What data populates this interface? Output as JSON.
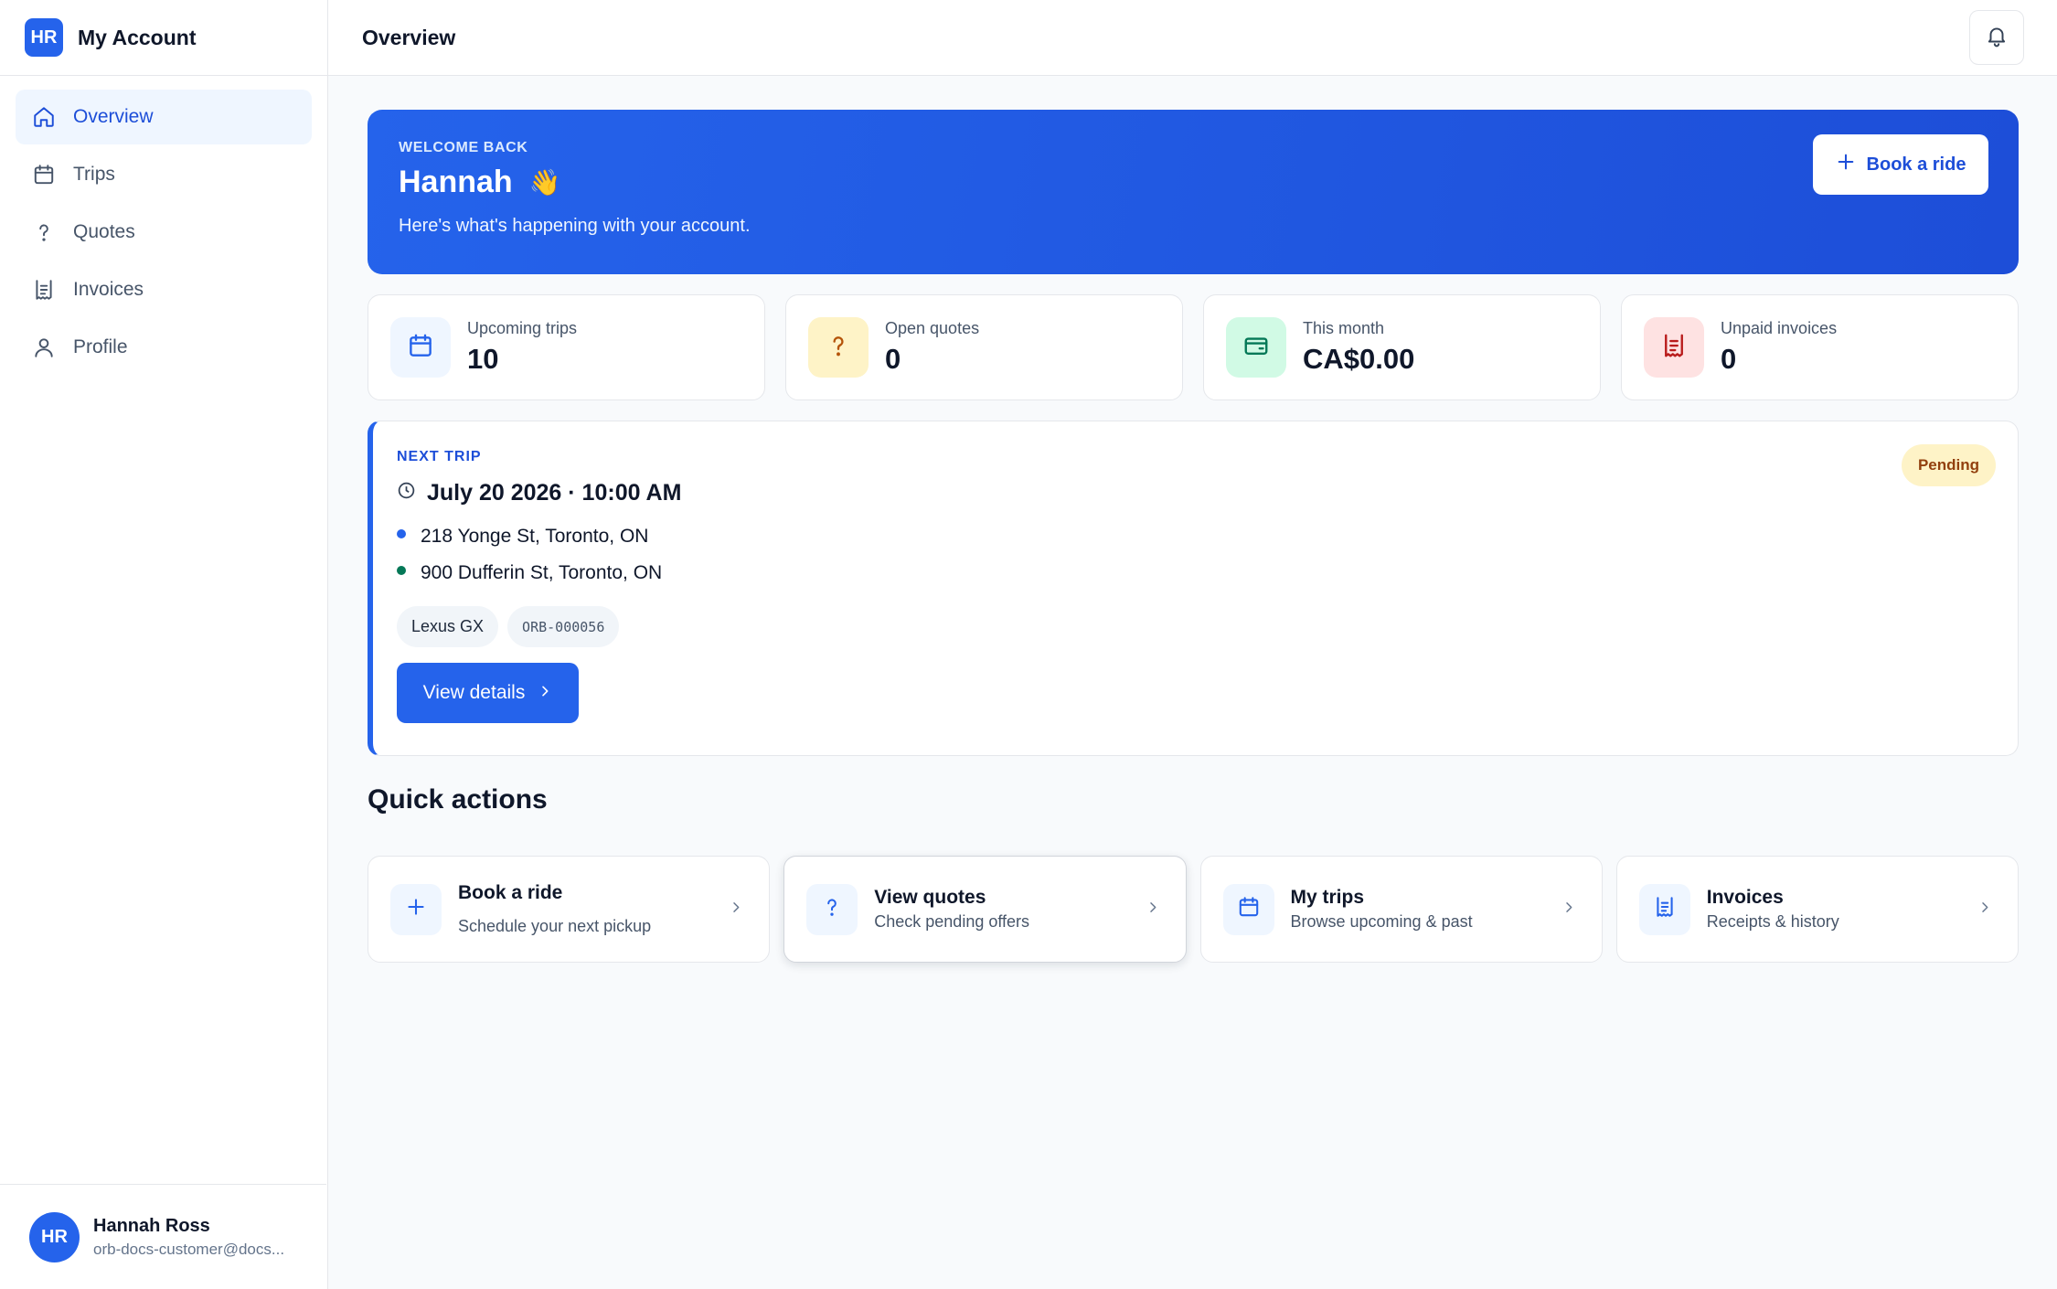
{
  "brand": {
    "initials": "HR",
    "title": "My Account"
  },
  "nav": {
    "items": [
      {
        "label": "Overview",
        "icon": "home-icon",
        "active": true
      },
      {
        "label": "Trips",
        "icon": "calendar-icon"
      },
      {
        "label": "Quotes",
        "icon": "question-icon"
      },
      {
        "label": "Invoices",
        "icon": "receipt-icon"
      },
      {
        "label": "Profile",
        "icon": "user-icon"
      }
    ]
  },
  "user": {
    "initials": "HR",
    "name": "Hannah Ross",
    "email": "orb-docs-customer@docs..."
  },
  "topbar": {
    "title": "Overview",
    "notifications_icon": "bell-icon"
  },
  "hero": {
    "eyebrow": "WELCOME BACK",
    "name": "Hannah",
    "emoji": "👋",
    "subtitle": "Here's what's happening with your account.",
    "cta_label": "Book a ride"
  },
  "stats": [
    {
      "label": "Upcoming trips",
      "value": "10",
      "icon": "calendar-icon",
      "bg": "#eff6ff",
      "fg": "#2563eb"
    },
    {
      "label": "Open quotes",
      "value": "0",
      "icon": "question-icon",
      "bg": "#fef3c7",
      "fg": "#b45309"
    },
    {
      "label": "This month",
      "value": "CA$0.00",
      "icon": "wallet-icon",
      "bg": "#d1fae5",
      "fg": "#047857"
    },
    {
      "label": "Unpaid invoices",
      "value": "0",
      "icon": "receipt-icon",
      "bg": "#fee2e2",
      "fg": "#b91c1c"
    }
  ],
  "next_trip": {
    "eyebrow": "NEXT TRIP",
    "datetime": "July 20 2026 · 10:00 AM",
    "pickup": "218 Yonge St, Toronto, ON",
    "dropoff": "900 Dufferin St, Toronto, ON",
    "vehicle": "Lexus GX",
    "reference": "ORB-000056",
    "status": "Pending",
    "button_label": "View details",
    "colors": {
      "pickup_dot": "#2563eb",
      "dropoff_dot": "#047857",
      "accent": "#2563eb"
    }
  },
  "quick_actions": {
    "title": "Quick actions",
    "items": [
      {
        "title": "Book a ride",
        "subtitle": "Schedule your next pickup",
        "icon": "plus-icon"
      },
      {
        "title": "View quotes",
        "subtitle": "Check pending offers",
        "icon": "question-icon"
      },
      {
        "title": "My trips",
        "subtitle": "Browse upcoming & past",
        "icon": "calendar-icon"
      },
      {
        "title": "Invoices",
        "subtitle": "Receipts & history",
        "icon": "receipt-icon"
      }
    ]
  }
}
